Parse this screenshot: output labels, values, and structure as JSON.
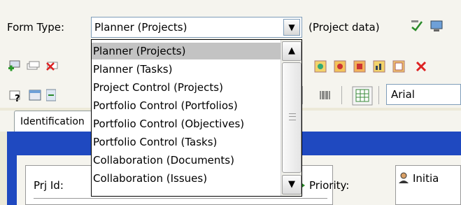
{
  "form": {
    "label": "Form Type:",
    "selected": "Planner (Projects)",
    "context_label": "(Project data)"
  },
  "dropdown": {
    "items": [
      "Planner (Projects)",
      "Planner (Tasks)",
      "Project Control (Projects)",
      "Portfolio Control (Portfolios)",
      "Portfolio Control (Objectives)",
      "Portfolio Control (Tasks)",
      "Collaboration (Documents)",
      "Collaboration (Issues)"
    ],
    "highlighted_index": 0
  },
  "toolbar": {
    "font_name": "Arial"
  },
  "tabs": {
    "active": "Identification"
  },
  "panel": {
    "prj_id_label": "Prj Id:",
    "priority_label": "Priority:",
    "initia_label": "Initia"
  },
  "colors": {
    "frame_blue": "#1f49c0",
    "selected_item": "#c3c3c3"
  }
}
